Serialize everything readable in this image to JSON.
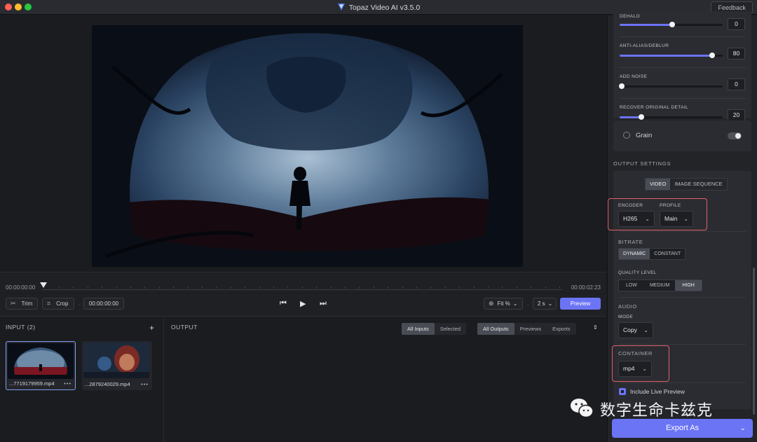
{
  "window": {
    "title": "Topaz Video AI  v3.5.0",
    "feedback_label": "Feedback"
  },
  "timeline": {
    "start_time": "00:00:00:00",
    "end_time": "00:00:02:23"
  },
  "controls": {
    "trim_label": "Trim",
    "crop_label": "Crop",
    "timecode": "00:00:00:00",
    "zoom_label": "Fit %",
    "step_label": "2 s",
    "preview_label": "Preview"
  },
  "input_panel": {
    "title": "INPUT (2)",
    "files": [
      {
        "name": "...7719179959.mp4",
        "selected": true
      },
      {
        "name": "...2879240029.mp4",
        "selected": false
      }
    ]
  },
  "output_panel": {
    "title": "OUTPUT",
    "filter_inputs": [
      "All Inputs",
      "Selected"
    ],
    "filter_outputs": [
      "All Outputs",
      "Previews",
      "Exports"
    ]
  },
  "enhancement": {
    "sliders": [
      {
        "label": "DEHALO",
        "value": "0",
        "fraction": 0.51
      },
      {
        "label": "ANTI-ALIAS/DEBLUR",
        "value": "80",
        "fraction": 0.9
      },
      {
        "label": "ADD NOISE",
        "value": "0",
        "fraction": 0.02
      },
      {
        "label": "RECOVER ORIGINAL DETAIL",
        "value": "20",
        "fraction": 0.21
      }
    ],
    "grain_label": "Grain",
    "grain_enabled": false
  },
  "output_settings": {
    "title": "OUTPUT SETTINGS",
    "tabs": [
      "VIDEO",
      "IMAGE SEQUENCE"
    ],
    "active_tab": "VIDEO",
    "encoder_label": "ENCODER",
    "encoder_value": "H265",
    "profile_label": "PROFILE",
    "profile_value": "Main",
    "bitrate_label": "BITRATE",
    "bitrate_options": [
      "DYNAMIC",
      "CONSTANT"
    ],
    "bitrate_active": "DYNAMIC",
    "quality_label": "QUALITY LEVEL",
    "quality_options": [
      "LOW",
      "MEDIUM",
      "HIGH"
    ],
    "quality_active": "HIGH",
    "audio_label": "AUDIO",
    "mode_label": "MODE",
    "mode_value": "Copy",
    "container_label": "CONTAINER",
    "container_value": "mp4",
    "live_preview_label": "Include Live Preview",
    "live_preview_checked": true
  },
  "export": {
    "label": "Export As"
  },
  "watermark": {
    "text": "数字生命卡兹克"
  },
  "colors": {
    "accent": "#6b74f5",
    "highlight": "#e0606a",
    "panel": "#232428"
  }
}
